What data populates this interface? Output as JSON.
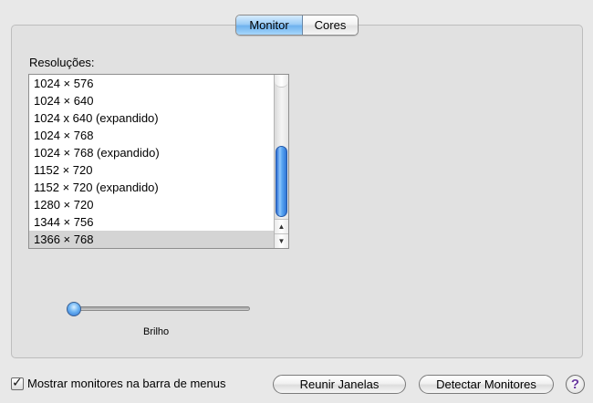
{
  "tabs": {
    "items": [
      {
        "label": "Monitor",
        "active": true
      },
      {
        "label": "Cores",
        "active": false
      }
    ]
  },
  "resolutions": {
    "label": "Resoluções:",
    "items": [
      "1024 × 576",
      "1024 × 640",
      "1024 x 640 (expandido)",
      "1024 × 768",
      "1024 × 768 (expandido)",
      "1152 × 720",
      "1152 × 720 (expandido)",
      "1280 × 720",
      "1344 × 756",
      "1366 × 768"
    ],
    "selected": "1366 × 768"
  },
  "brightness": {
    "label": "Brilho",
    "level": 0.0
  },
  "footer": {
    "show_in_menubar_label": "Mostrar monitores na barra de menus",
    "show_in_menubar_checked": true,
    "gather_windows_label": "Reunir Janelas",
    "detect_displays_label": "Detectar Monitores",
    "help_label": "?"
  },
  "colors": {
    "accent": "#6eb2ee",
    "help_glyph": "#6a3aa0"
  }
}
